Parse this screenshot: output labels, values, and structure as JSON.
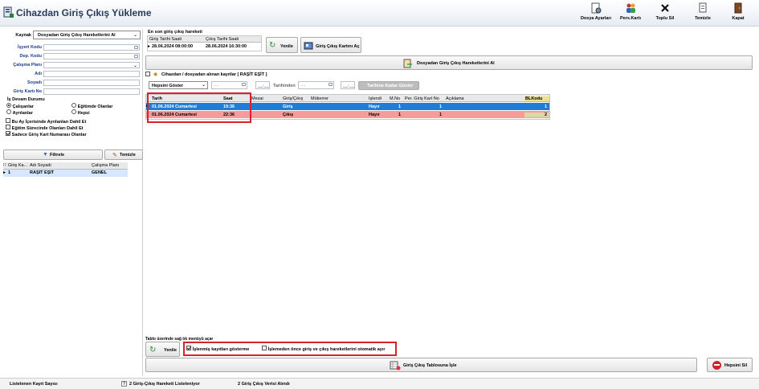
{
  "app": {
    "title": "Cihazdan Giriş Çıkış Yükleme"
  },
  "toolbar": [
    {
      "label": "Dosya Ayarları",
      "icon": "document-settings-icon"
    },
    {
      "label": "Pers.Kartı",
      "icon": "users-icon"
    },
    {
      "label": "Toplu Sil",
      "icon": "delete-icon"
    },
    {
      "label": "Temizle",
      "icon": "clear-icon"
    },
    {
      "label": "Kapat",
      "icon": "door-exit-icon"
    }
  ],
  "left": {
    "source_label": "Kaynak",
    "source_value": "Dosyadan Giriş Çıkış Hareketlerini Al",
    "fields": [
      {
        "label": "İşyeri Kodu",
        "value": ""
      },
      {
        "label": "Dep. Kodu",
        "value": ""
      },
      {
        "label": "Çalışma Planı",
        "value": ""
      },
      {
        "label": "Adı",
        "value": ""
      },
      {
        "label": "Soyadı",
        "value": ""
      },
      {
        "label": "Giriş Kartı No",
        "value": ""
      }
    ],
    "status_group": "İş Devam Durumu",
    "radios": [
      {
        "label": "Çalışanlar",
        "checked": true
      },
      {
        "label": "Eğitimde Olanlar",
        "checked": false
      },
      {
        "label": "Ayrılanlar",
        "checked": false
      },
      {
        "label": "Hepsi",
        "checked": false
      }
    ],
    "checks": [
      {
        "label": "Bu Ay İçerisinde Ayrılanları Dahil Et",
        "checked": false
      },
      {
        "label": "Eğitim Sürecinde Olanları Dahil Et",
        "checked": false
      },
      {
        "label": "Sadece Giriş Kart Numarası Olanlar",
        "checked": true
      }
    ],
    "filter_button": "Filtrele",
    "clear_button": "Temizle",
    "grid_headers": [
      "Giriş Ka...",
      "Adı Soyadı",
      "Çalışma Planı"
    ],
    "grid_rows": [
      [
        "1",
        "RAŞİT EŞİT",
        "GENEL"
      ]
    ]
  },
  "last": {
    "title": "En son giriş çıkış hareketi",
    "headers": [
      "Giriş Tarihi Saati",
      "Çıkış Tarihi Saati"
    ],
    "row": [
      "28.06.2024 08:00:00",
      "28.06.2024 16:30:00"
    ]
  },
  "actions": {
    "refresh": "Yenile",
    "open_card": "Giriş Çıkış Kartını Aç",
    "get_from_file": "Dosyadan Giriş Çıkış Hareketlerini Al"
  },
  "section": {
    "title": "Cihazdan / dosyadan alınan kayıtlar [ RAŞİT EŞİT ]"
  },
  "filter": {
    "show": "Hepsini Göster",
    "date1": "- -",
    "time1": "__:__",
    "between_label": "Tarihinden",
    "date2": "- -",
    "time2": "__:__",
    "apply_button": "Tarihine Kadar Göster"
  },
  "records": {
    "headers": [
      "Tarih",
      "Saat",
      "Mesai",
      "Giriş/Çıkış",
      "Mükerrer",
      "İşlendi",
      "M.No",
      "Per. Giriş Kart No",
      "Açıklama",
      "BLKodu"
    ],
    "rows": [
      [
        "01.06.2024 Cumartesi",
        "19:36",
        "",
        "Giriş",
        "",
        "Hayır",
        "1",
        "1",
        "",
        "1"
      ],
      [
        "01.06.2024 Cumartesi",
        "22:36",
        "",
        "Çıkış",
        "",
        "Hayır",
        "1",
        "1",
        "",
        "2"
      ]
    ]
  },
  "footer": {
    "hint": "Tablo üzerinde sağ tık menüyü açar",
    "refresh": "Yenile",
    "show_processed": "İşlenmiş kayıtları gösterme",
    "auto_separate": "İşlemeden önce giriş ve çıkış hareketlerini  otomatik ayır",
    "process_button": "Giriş Çıkış Tablosuna İşle",
    "delete_all": "Hepsini Sil"
  },
  "status": {
    "listed": "Listelenen Kayıt Sayısı",
    "listed_count": "2 Giriş-Çıkış Hareketi Listeleniyor",
    "received": "2 Giriş Çıkış Verisi Alındı"
  }
}
